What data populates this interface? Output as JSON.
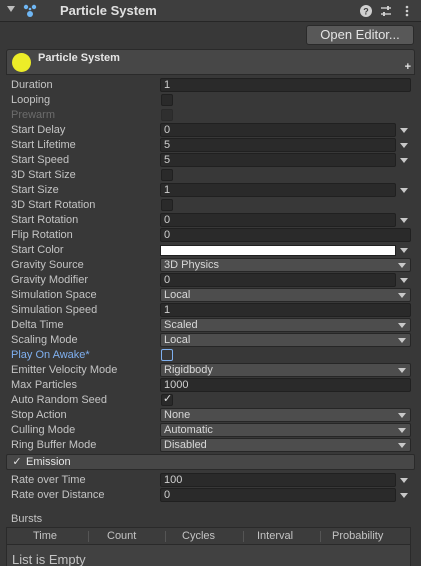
{
  "header": {
    "title": "Particle System",
    "icons": [
      "particle-system-icon",
      "help-icon",
      "preset-sliders-icon",
      "more-options-icon"
    ]
  },
  "toolbar": {
    "open_editor_label": "Open Editor..."
  },
  "main_module": {
    "title": "Particle System",
    "add_symbol": "+"
  },
  "properties": {
    "duration": {
      "label": "Duration",
      "value": "1"
    },
    "looping": {
      "label": "Looping",
      "checked": false
    },
    "prewarm": {
      "label": "Prewarm",
      "checked": false
    },
    "start_delay": {
      "label": "Start Delay",
      "value": "0"
    },
    "start_lifetime": {
      "label": "Start Lifetime",
      "value": "5"
    },
    "start_speed": {
      "label": "Start Speed",
      "value": "5"
    },
    "start_size_3d": {
      "label": "3D Start Size",
      "checked": false
    },
    "start_size": {
      "label": "Start Size",
      "value": "1"
    },
    "start_rotation_3d": {
      "label": "3D Start Rotation",
      "checked": false
    },
    "start_rotation": {
      "label": "Start Rotation",
      "value": "0"
    },
    "flip_rotation": {
      "label": "Flip Rotation",
      "value": "0"
    },
    "start_color": {
      "label": "Start Color",
      "color": "#ffffff"
    },
    "gravity_source": {
      "label": "Gravity Source",
      "value": "3D Physics"
    },
    "gravity_modifier": {
      "label": "Gravity Modifier",
      "value": "0"
    },
    "simulation_space": {
      "label": "Simulation Space",
      "value": "Local"
    },
    "simulation_speed": {
      "label": "Simulation Speed",
      "value": "1"
    },
    "delta_time": {
      "label": "Delta Time",
      "value": "Scaled"
    },
    "scaling_mode": {
      "label": "Scaling Mode",
      "value": "Local"
    },
    "play_on_awake": {
      "label": "Play On Awake*",
      "checked": false
    },
    "emitter_velocity_mode": {
      "label": "Emitter Velocity Mode",
      "value": "Rigidbody"
    },
    "max_particles": {
      "label": "Max Particles",
      "value": "1000"
    },
    "auto_random_seed": {
      "label": "Auto Random Seed",
      "checked": true
    },
    "stop_action": {
      "label": "Stop Action",
      "value": "None"
    },
    "culling_mode": {
      "label": "Culling Mode",
      "value": "Automatic"
    },
    "ring_buffer_mode": {
      "label": "Ring Buffer Mode",
      "value": "Disabled"
    }
  },
  "emission": {
    "title": "Emission",
    "enabled": true,
    "rate_over_time": {
      "label": "Rate over Time",
      "value": "100"
    },
    "rate_over_distance": {
      "label": "Rate over Distance",
      "value": "0"
    },
    "bursts": {
      "label": "Bursts",
      "columns": [
        "Time",
        "Count",
        "Cycles",
        "Interval",
        "Probability"
      ],
      "empty_text": "List is Empty"
    }
  },
  "colors": {
    "background": "#383838",
    "field": "#2a2a2a",
    "accent_blue": "#7fb0f0",
    "start_color_swatch": "#ffffff",
    "module_icon": "#ecec28"
  }
}
